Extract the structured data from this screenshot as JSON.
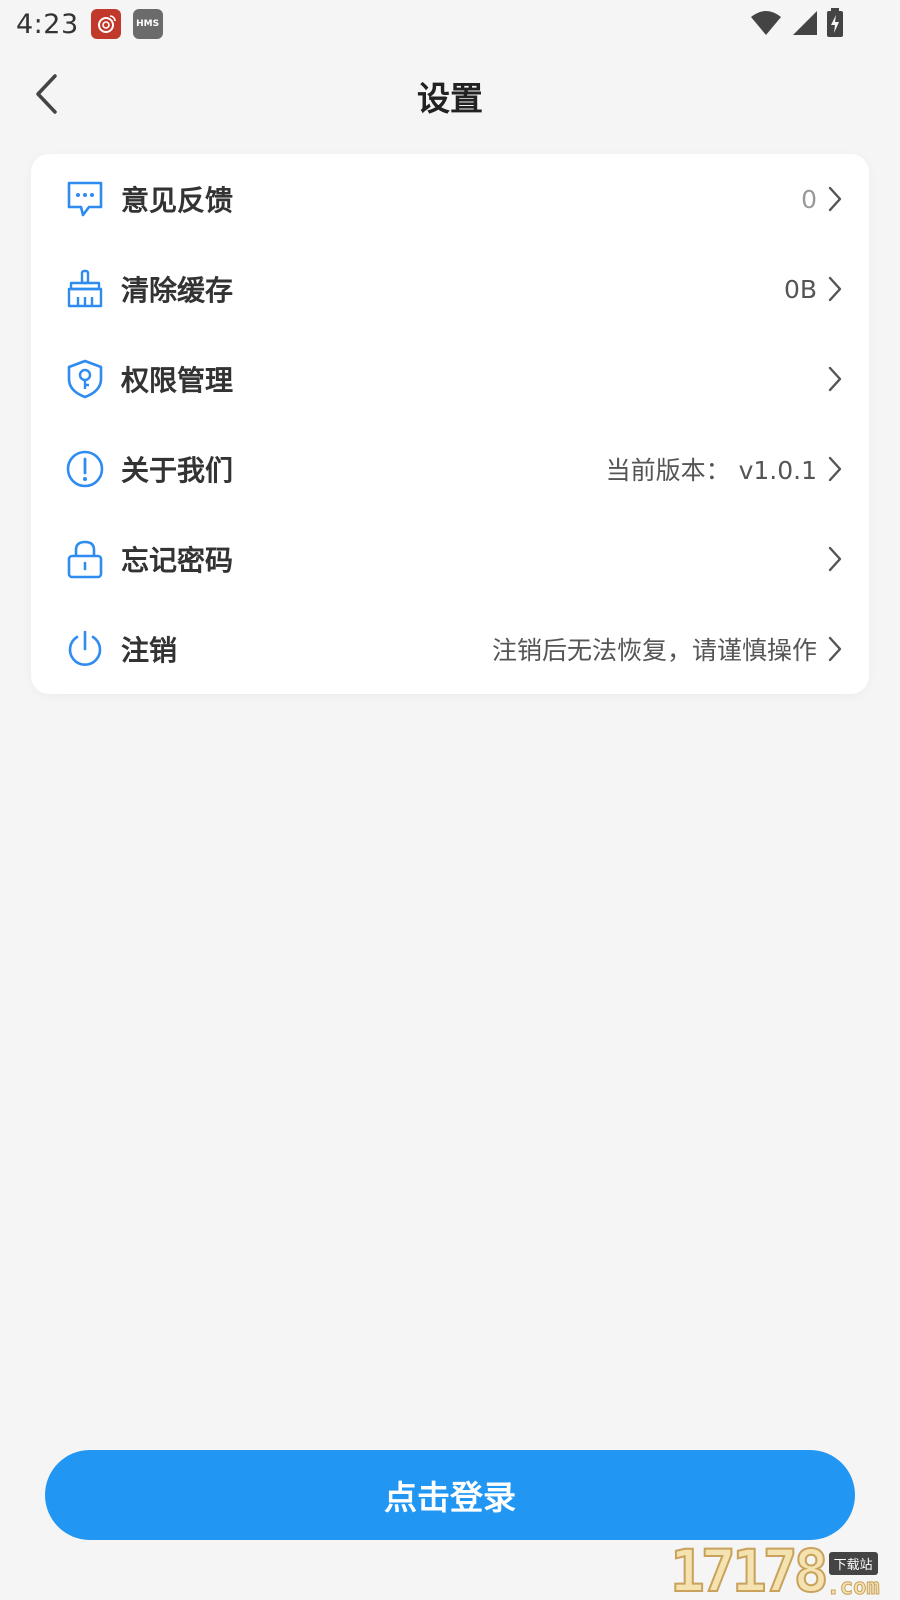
{
  "status_bar": {
    "time": "4:23",
    "hms_label": "HMS",
    "icons": [
      "weibo-icon",
      "hms-icon",
      "wifi-icon",
      "signal-icon",
      "battery-charging-icon"
    ]
  },
  "header": {
    "title": "设置",
    "back_icon": "chevron-left-icon"
  },
  "settings": {
    "items": [
      {
        "label": "意见反馈",
        "value": "0",
        "icon": "message-bubble-icon"
      },
      {
        "label": "清除缓存",
        "value": "0B",
        "icon": "broom-icon"
      },
      {
        "label": "权限管理",
        "value": "",
        "icon": "shield-key-icon"
      },
      {
        "label": "关于我们",
        "value": "当前版本： v1.0.1",
        "icon": "info-exclamation-icon"
      },
      {
        "label": "忘记密码",
        "value": "",
        "icon": "lock-icon"
      },
      {
        "label": "注销",
        "value": "注销后无法恢复，请谨慎操作",
        "icon": "power-icon"
      }
    ]
  },
  "login": {
    "label": "点击登录"
  },
  "watermark": {
    "digits": "17178",
    "badge": "下载站",
    "suffix": ".com"
  },
  "colors": {
    "accent": "#2196f3",
    "icon_blue": "#2e8bf0",
    "background": "#f5f5f5",
    "card": "#ffffff"
  }
}
